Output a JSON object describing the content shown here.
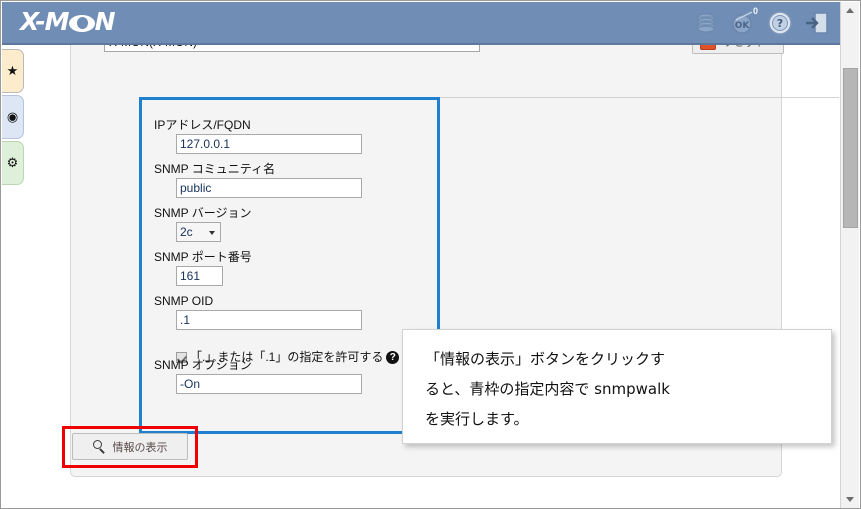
{
  "header": {
    "logo_text_before": "X-M",
    "logo_text_after": "N",
    "icons": [
      {
        "name": "database-icon",
        "label": "database"
      },
      {
        "name": "ok-status-icon",
        "label": "OK",
        "badge": "0"
      },
      {
        "name": "help-icon",
        "label": "?"
      },
      {
        "name": "logout-icon",
        "label": "logout"
      }
    ]
  },
  "side_tabs": [
    {
      "name": "sidebar-tab-favorites",
      "glyph": "★"
    },
    {
      "name": "sidebar-tab-monitor",
      "glyph": "◉"
    },
    {
      "name": "sidebar-tab-settings",
      "glyph": "⚙"
    }
  ],
  "toolbar": {
    "host_select_value": "X-MON(X-MON)",
    "reset_label": "リセット"
  },
  "form": {
    "ip_label": "IPアドレス/FQDN",
    "ip_value": "127.0.0.1",
    "community_label": "SNMP コミュニティ名",
    "community_value": "public",
    "version_label": "SNMP バージョン",
    "version_value": "2c",
    "port_label": "SNMP ポート番号",
    "port_value": "161",
    "oid_label": "SNMP OID",
    "oid_value": ".1",
    "oid_allow_label": "「.」または「.1」の指定を許可する",
    "oid_help_glyph": "?",
    "option_label": "SNMP オプション",
    "option_value": "-On"
  },
  "actions": {
    "show_info_label": "情報の表示"
  },
  "callout": {
    "line1": "「情報の表示」ボタンをクリックす",
    "line2": "ると、青枠の指定内容で snmpwalk",
    "line3": "を実行します。"
  },
  "colors": {
    "header_bg": "#6f8db5",
    "highlight_blue": "#1f7fd0",
    "annotation_red": "#ee0000",
    "panel_bg": "#f4f4f4"
  }
}
